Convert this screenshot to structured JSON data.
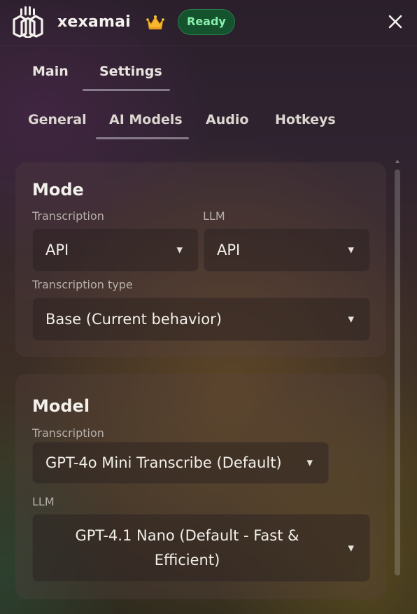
{
  "app": {
    "title": "xexamai",
    "status": "Ready",
    "logo_icon": "xexamai-logo",
    "crown_icon": "crown-icon",
    "close_icon": "close-icon",
    "status_color": "#86efac"
  },
  "main_tabs": [
    {
      "label": "Main",
      "active": false
    },
    {
      "label": "Settings",
      "active": true
    }
  ],
  "sub_tabs": [
    {
      "label": "General",
      "active": false
    },
    {
      "label": "AI Models",
      "active": true
    },
    {
      "label": "Audio",
      "active": false
    },
    {
      "label": "Hotkeys",
      "active": false
    }
  ],
  "mode": {
    "title": "Mode",
    "transcription_label": "Transcription",
    "transcription_value": "API",
    "llm_label": "LLM",
    "llm_value": "API",
    "transcription_type_label": "Transcription type",
    "transcription_type_value": "Base (Current behavior)"
  },
  "model": {
    "title": "Model",
    "transcription_label": "Transcription",
    "transcription_value": "GPT-4o Mini Transcribe (Default)",
    "llm_label": "LLM",
    "llm_value": "GPT-4.1 Nano (Default - Fast & Efficient)"
  }
}
